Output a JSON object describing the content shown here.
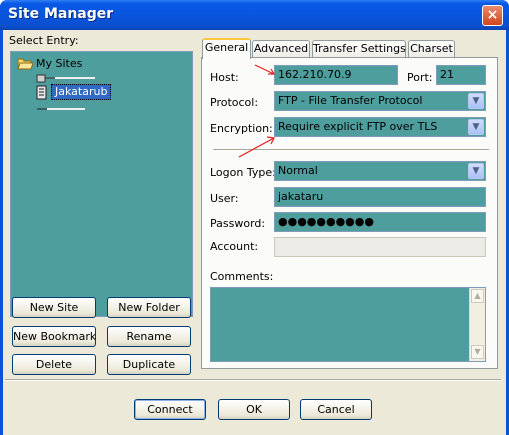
{
  "window": {
    "title": "Site Manager",
    "close": "×"
  },
  "select_entry": {
    "label": "Select Entry:"
  },
  "tree": {
    "root": "My Sites",
    "items": [
      "Jakatarub"
    ]
  },
  "left_buttons": {
    "new_site": "New Site",
    "new_folder": "New Folder",
    "new_bookmark": "New Bookmark",
    "rename": "Rename",
    "delete": "Delete",
    "duplicate": "Duplicate"
  },
  "tabs": [
    "General",
    "Advanced",
    "Transfer Settings",
    "Charset"
  ],
  "general": {
    "host_label": "Host:",
    "host_value": "162.210.70.9",
    "port_label": "Port:",
    "port_value": "21",
    "protocol_label": "Protocol:",
    "protocol_value": "FTP - File Transfer Protocol",
    "encryption_label": "Encryption:",
    "encryption_value": "Require explicit FTP over TLS",
    "logon_type_label": "Logon Type:",
    "logon_type_value": "Normal",
    "user_label": "User:",
    "user_value": "jakataru",
    "password_label": "Password:",
    "password_value": "●●●●●●●●●●",
    "account_label": "Account:",
    "account_value": "",
    "comments_label": "Comments:",
    "comments_value": ""
  },
  "bottom_buttons": {
    "connect": "Connect",
    "ok": "OK",
    "cancel": "Cancel"
  },
  "colors": {
    "titlebar": "#0a55dd",
    "field_bg": "#4f9e9e",
    "annotation_arrow": "#e02020"
  },
  "icons": {
    "folder": "folder-open-icon",
    "site": "server-icon",
    "dropdown": "chevron-down-icon"
  }
}
